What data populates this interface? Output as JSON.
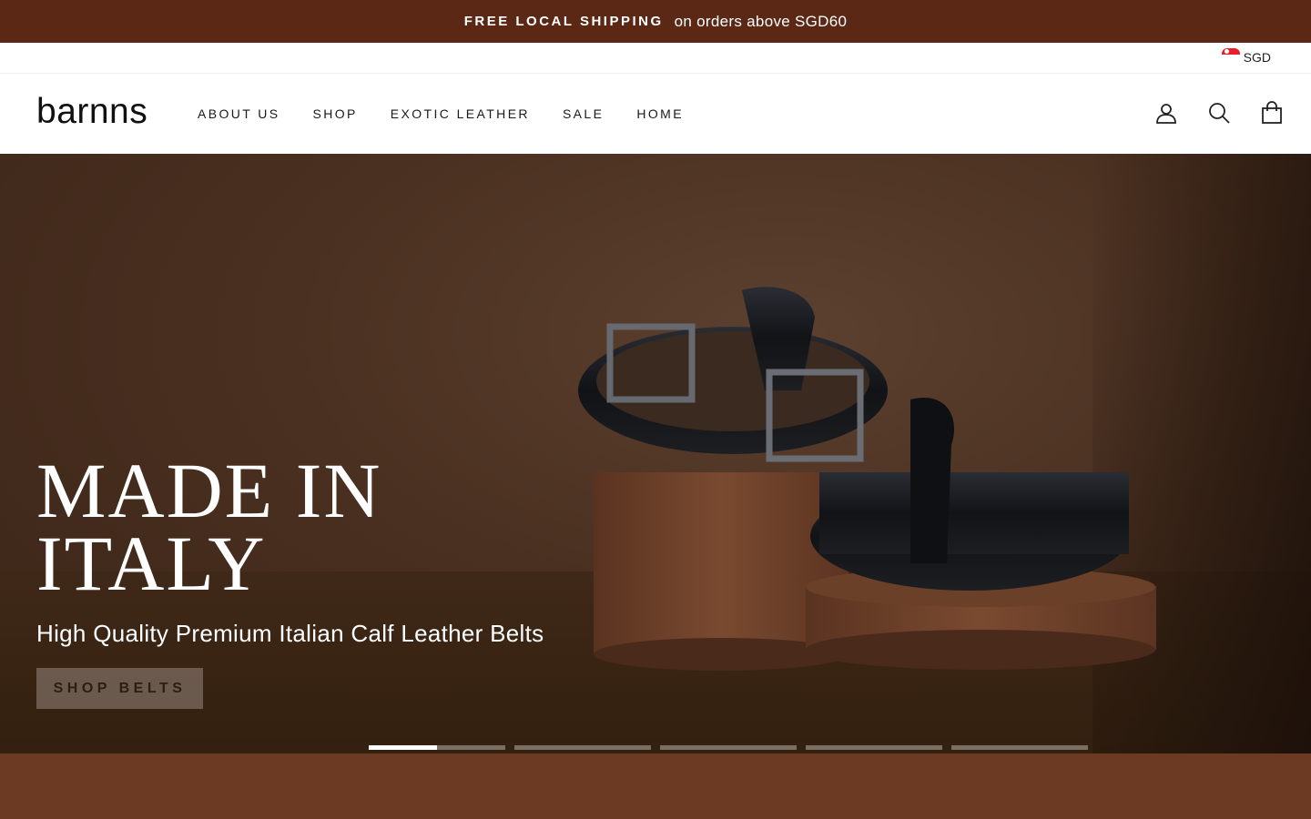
{
  "announcement": {
    "bold": "FREE LOCAL SHIPPING",
    "text": "on orders above SGD60"
  },
  "currency": {
    "code": "SGD",
    "flag_icon": "singapore-flag-icon"
  },
  "header": {
    "logo": "barnns",
    "nav": [
      "ABOUT US",
      "SHOP",
      "EXOTIC LEATHER",
      "SALE",
      "HOME"
    ],
    "icons": [
      "account-icon",
      "search-icon",
      "cart-icon"
    ]
  },
  "hero": {
    "title": "MADE IN\nITALY",
    "subtitle": "High Quality Premium Italian Calf Leather Belts",
    "button": "SHOP BELTS",
    "slide_count": 5,
    "active_slide": 1,
    "active_progress": 0.5
  },
  "colors": {
    "announcement_bg": "#5a2815",
    "band_bg": "#6c3a22",
    "hero_bg": "#4a3020"
  }
}
